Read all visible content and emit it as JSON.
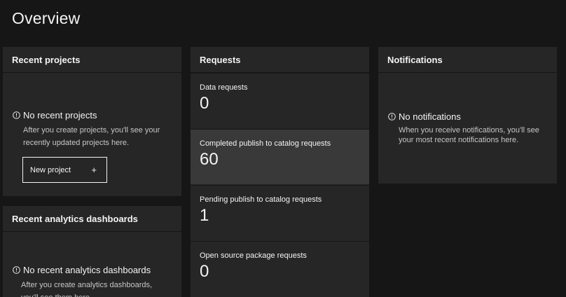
{
  "page": {
    "title": "Overview"
  },
  "recent_projects": {
    "title": "Recent projects",
    "empty_title": "No recent projects",
    "empty_desc_line1": "After you create projects, you'll see your",
    "empty_desc_line2": "recently updated projects here.",
    "new_project_label": "New project",
    "new_project_icon": "+"
  },
  "recent_dashboards": {
    "title": "Recent analytics dashboards",
    "empty_title": "No recent analytics dashboards",
    "empty_desc_line1": "After you create analytics dashboards,",
    "empty_desc_line2": "you'll see them here."
  },
  "requests": {
    "title": "Requests",
    "items": [
      {
        "label": "Data requests",
        "value": "0"
      },
      {
        "label": "Completed publish to catalog requests",
        "value": "60"
      },
      {
        "label": "Pending publish to catalog requests",
        "value": "1"
      },
      {
        "label": "Open source package requests",
        "value": "0"
      }
    ]
  },
  "notifications": {
    "title": "Notifications",
    "empty_title": "No notifications",
    "empty_desc_line1": "When you receive notifications, you'll see",
    "empty_desc_line2": "your most recent notifications here."
  },
  "icons": {
    "info": "information-icon",
    "add": "add-icon"
  },
  "colors": {
    "background": "#161616",
    "tile": "#262626",
    "tile_active": "#393939",
    "text_primary": "#f4f4f4",
    "text_secondary": "#c6c6c6"
  }
}
